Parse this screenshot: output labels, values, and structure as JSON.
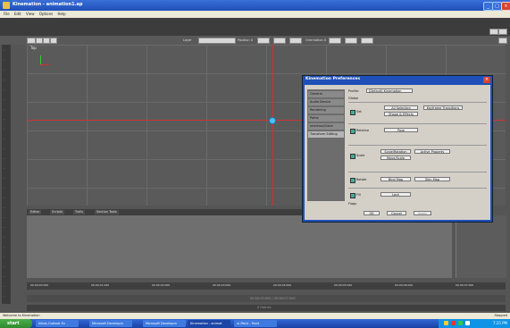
{
  "window": {
    "title": "Kinemation - animation1.ap"
  },
  "menu": [
    "File",
    "Edit",
    "View",
    "Options",
    "Help"
  ],
  "viewport": {
    "label": "Top"
  },
  "toolbar": {
    "layer_label": "Layer",
    "position_label": "Position X",
    "orientation_label": "Orientation X"
  },
  "panel_tabs": [
    "Editor",
    "Scripts",
    "Trails",
    "Section Tools"
  ],
  "timeline_ticks": [
    "00:00:00:000",
    "00:00:01:000",
    "00:00:02:000",
    "00:00:03:000",
    "00:00:04:000",
    "00:00:05:000",
    "00:00:06:000",
    "00:00:07:000"
  ],
  "time_readout": "00:00:00:000 / 00:00:07:000",
  "frame_readout": "0 frames",
  "status": {
    "left": "Welcome to Kinemation",
    "right": "Stopped"
  },
  "dialog": {
    "title": "Kinemation Preferences",
    "categories": [
      "General",
      "Audio Device",
      "Rendering",
      "Paths",
      "Interface/Color",
      "Transform Editing"
    ],
    "selected_category": "Transform Editing",
    "profile_label": "Profile:",
    "profile_value": "[Default] Kinemation",
    "section_label": "Global",
    "rows": [
      {
        "label": "Set",
        "buttons": [
          "All Selection",
          "Keyframe Transitions",
          "Shape & Effects"
        ],
        "checked": true
      },
      {
        "label": "Relative",
        "buttons": [
          "Pose"
        ],
        "checked": true
      },
      {
        "label": "Scale",
        "buttons": [
          "Scale/Rotation",
          "Active Property",
          "Move/Scale"
        ],
        "checked": true
      },
      {
        "label": "Rotate",
        "buttons": [
          "Bind Map",
          "Skin Map"
        ],
        "checked": true
      },
      {
        "label": "Fill",
        "buttons": [
          "Lock"
        ],
        "checked": true
      }
    ],
    "footer_hint": "Flags",
    "ok": "OK",
    "cancel": "Cancel",
    "apply": "Apply"
  },
  "taskbar": {
    "start": "start",
    "tasks": [
      "Inbox-Outlook Ex",
      "Microsoft Developm",
      "Microsoft Developm",
      "Kinemation - animat",
      "ui-Paint - Paint"
    ],
    "active_index": 3,
    "clock": "7:25 PM"
  },
  "colors": {
    "accent": "#1f4fb8",
    "axis_red": "#cc3333",
    "cursor": "#4ac3ff"
  }
}
